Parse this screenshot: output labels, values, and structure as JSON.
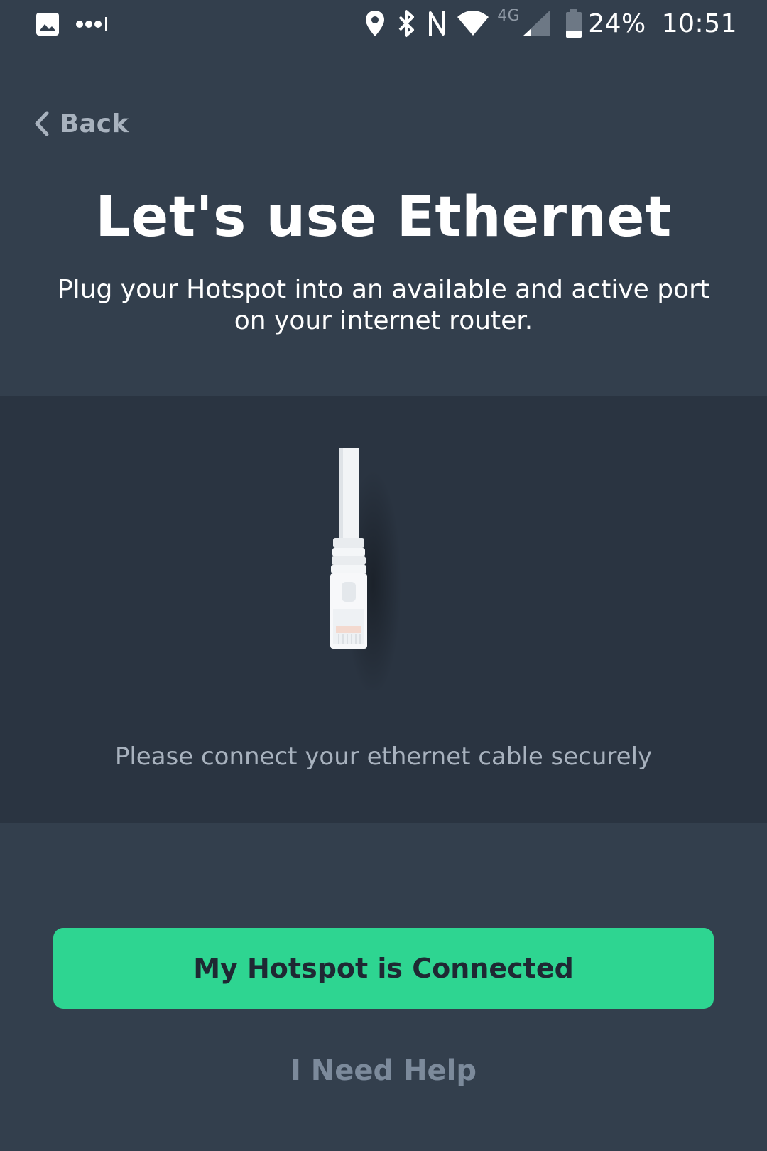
{
  "status_bar": {
    "left_icons": [
      "image-icon",
      "signal-dots-icon"
    ],
    "right_icons": [
      "location-icon",
      "bluetooth-icon",
      "nfc-icon",
      "wifi-icon",
      "cell-signal-icon",
      "battery-icon"
    ],
    "network_type": "4G",
    "battery_percent": "24%",
    "time": "10:51"
  },
  "nav": {
    "back_label": "Back"
  },
  "header": {
    "title": "Let's use Ethernet",
    "subtitle_line1": "Plug your Hotspot into an available and active port",
    "subtitle_line2": "on your internet router."
  },
  "illustration": {
    "icon": "ethernet-cable-icon",
    "caption": "Please connect your ethernet cable securely"
  },
  "actions": {
    "primary_label": "My Hotspot is Connected",
    "help_label": "I Need Help"
  },
  "colors": {
    "background": "#333f4d",
    "panel": "#2a3441",
    "accent": "#2ed591",
    "muted_text": "#a8b2be",
    "link_text": "#7c8a9b"
  }
}
